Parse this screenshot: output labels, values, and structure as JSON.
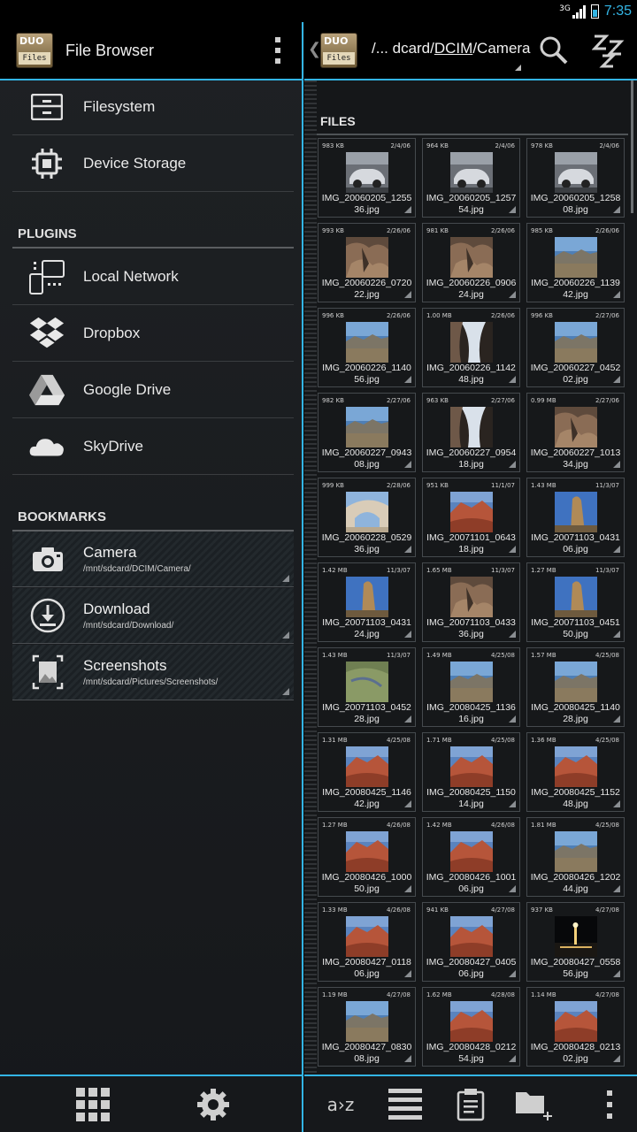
{
  "status_bar": {
    "network": "3G",
    "time": "7:35"
  },
  "left_pane": {
    "logo": {
      "line1": "DUO",
      "line2": "Files"
    },
    "title": "File Browser",
    "locations": [
      {
        "label": "Filesystem",
        "icon": "drive-icon"
      },
      {
        "label": "Device Storage",
        "icon": "chip-icon"
      }
    ],
    "plugins_title": "PLUGINS",
    "plugins": [
      {
        "label": "Local Network",
        "icon": "network-icon"
      },
      {
        "label": "Dropbox",
        "icon": "dropbox-icon"
      },
      {
        "label": "Google Drive",
        "icon": "google-drive-icon"
      },
      {
        "label": "SkyDrive",
        "icon": "skydrive-icon"
      }
    ],
    "bookmarks_title": "BOOKMARKS",
    "bookmarks": [
      {
        "name": "Camera",
        "path": "/mnt/sdcard/DCIM/Camera/",
        "icon": "camera-icon"
      },
      {
        "name": "Download",
        "path": "/mnt/sdcard/Download/",
        "icon": "download-icon"
      },
      {
        "name": "Screenshots",
        "path": "/mnt/sdcard/Pictures/Screenshots/",
        "icon": "screenshot-icon"
      }
    ],
    "bottom_bar": [
      "grid-icon",
      "settings-icon"
    ]
  },
  "right_pane": {
    "breadcrumb": {
      "prefix": "/... dcard/",
      "segment": "DCIM",
      "suffix": "/Camera"
    },
    "files_title": "FILES",
    "bottom_bar": {
      "sort_label": "a›z"
    },
    "files": [
      {
        "size": "983 KB",
        "date": "2/4/06",
        "name1": "IMG_20060205_1255",
        "name2": "36.jpg",
        "thumb": "car"
      },
      {
        "size": "964 KB",
        "date": "2/4/06",
        "name1": "IMG_20060205_1257",
        "name2": "54.jpg",
        "thumb": "car"
      },
      {
        "size": "978 KB",
        "date": "2/4/06",
        "name1": "IMG_20060205_1258",
        "name2": "08.jpg",
        "thumb": "car"
      },
      {
        "size": "993 KB",
        "date": "2/26/06",
        "name1": "IMG_20060226_0720",
        "name2": "22.jpg",
        "thumb": "rock"
      },
      {
        "size": "981 KB",
        "date": "2/26/06",
        "name1": "IMG_20060226_0906",
        "name2": "24.jpg",
        "thumb": "rock"
      },
      {
        "size": "985 KB",
        "date": "2/26/06",
        "name1": "IMG_20060226_1139",
        "name2": "42.jpg",
        "thumb": "landscape"
      },
      {
        "size": "996 KB",
        "date": "2/26/06",
        "name1": "IMG_20060226_1140",
        "name2": "56.jpg",
        "thumb": "landscape"
      },
      {
        "size": "1.00 MB",
        "date": "2/26/06",
        "name1": "IMG_20060226_1142",
        "name2": "48.jpg",
        "thumb": "cave"
      },
      {
        "size": "996 KB",
        "date": "2/27/06",
        "name1": "IMG_20060227_0452",
        "name2": "02.jpg",
        "thumb": "landscape"
      },
      {
        "size": "982 KB",
        "date": "2/27/06",
        "name1": "IMG_20060227_0943",
        "name2": "08.jpg",
        "thumb": "landscape"
      },
      {
        "size": "963 KB",
        "date": "2/27/06",
        "name1": "IMG_20060227_0954",
        "name2": "18.jpg",
        "thumb": "cave"
      },
      {
        "size": "0.99 MB",
        "date": "2/27/06",
        "name1": "IMG_20060227_1013",
        "name2": "34.jpg",
        "thumb": "rock"
      },
      {
        "size": "999 KB",
        "date": "2/28/06",
        "name1": "IMG_20060228_0529",
        "name2": "36.jpg",
        "thumb": "arch"
      },
      {
        "size": "951 KB",
        "date": "11/1/07",
        "name1": "IMG_20071101_0643",
        "name2": "18.jpg",
        "thumb": "red"
      },
      {
        "size": "1.43 MB",
        "date": "11/3/07",
        "name1": "IMG_20071103_0431",
        "name2": "06.jpg",
        "thumb": "spire"
      },
      {
        "size": "1.42 MB",
        "date": "11/3/07",
        "name1": "IMG_20071103_0431",
        "name2": "24.jpg",
        "thumb": "spire"
      },
      {
        "size": "1.65 MB",
        "date": "11/3/07",
        "name1": "IMG_20071103_0433",
        "name2": "36.jpg",
        "thumb": "rock"
      },
      {
        "size": "1.27 MB",
        "date": "11/3/07",
        "name1": "IMG_20071103_0451",
        "name2": "50.jpg",
        "thumb": "spire"
      },
      {
        "size": "1.43 MB",
        "date": "11/3/07",
        "name1": "IMG_20071103_0452",
        "name2": "28.jpg",
        "thumb": "green"
      },
      {
        "size": "1.49 MB",
        "date": "4/25/08",
        "name1": "IMG_20080425_1136",
        "name2": "16.jpg",
        "thumb": "landscape"
      },
      {
        "size": "1.57 MB",
        "date": "4/25/08",
        "name1": "IMG_20080425_1140",
        "name2": "28.jpg",
        "thumb": "landscape"
      },
      {
        "size": "1.31 MB",
        "date": "4/25/08",
        "name1": "IMG_20080425_1146",
        "name2": "42.jpg",
        "thumb": "red"
      },
      {
        "size": "1.71 MB",
        "date": "4/25/08",
        "name1": "IMG_20080425_1150",
        "name2": "14.jpg",
        "thumb": "red"
      },
      {
        "size": "1.36 MB",
        "date": "4/25/08",
        "name1": "IMG_20080425_1152",
        "name2": "48.jpg",
        "thumb": "red"
      },
      {
        "size": "1.27 MB",
        "date": "4/26/08",
        "name1": "IMG_20080426_1000",
        "name2": "50.jpg",
        "thumb": "red"
      },
      {
        "size": "1.42 MB",
        "date": "4/26/08",
        "name1": "IMG_20080426_1001",
        "name2": "06.jpg",
        "thumb": "red"
      },
      {
        "size": "1.81 MB",
        "date": "4/25/08",
        "name1": "IMG_20080426_1202",
        "name2": "44.jpg",
        "thumb": "landscape"
      },
      {
        "size": "1.33 MB",
        "date": "4/26/08",
        "name1": "IMG_20080427_0118",
        "name2": "06.jpg",
        "thumb": "red"
      },
      {
        "size": "941 KB",
        "date": "4/27/08",
        "name1": "IMG_20080427_0405",
        "name2": "06.jpg",
        "thumb": "red"
      },
      {
        "size": "937 KB",
        "date": "4/27/08",
        "name1": "IMG_20080427_0558",
        "name2": "56.jpg",
        "thumb": "night"
      },
      {
        "size": "1.19 MB",
        "date": "4/27/08",
        "name1": "IMG_20080427_0830",
        "name2": "08.jpg",
        "thumb": "landscape"
      },
      {
        "size": "1.62 MB",
        "date": "4/28/08",
        "name1": "IMG_20080428_0212",
        "name2": "54.jpg",
        "thumb": "red"
      },
      {
        "size": "1.14 MB",
        "date": "4/27/08",
        "name1": "IMG_20080428_0213",
        "name2": "02.jpg",
        "thumb": "red"
      }
    ]
  }
}
